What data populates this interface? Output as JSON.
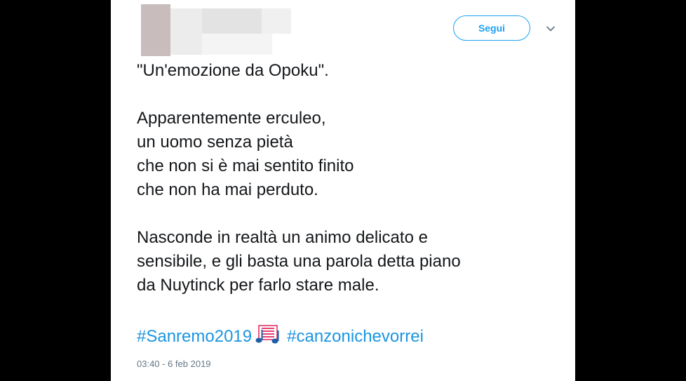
{
  "follow_button": {
    "label": "Segui"
  },
  "tweet": {
    "lines": [
      "\"Un'emozione da Opoku\".",
      "",
      "Apparentemente erculeo,",
      "un uomo senza pietà",
      "che non si è mai sentito finito",
      "che non ha mai perduto.",
      "",
      "Nasconde in realtà un animo delicato e",
      "sensibile, e gli basta una parola detta piano",
      "da Nuytinck per farlo stare male."
    ],
    "hashtags": [
      "#Sanremo2019",
      "#canzonichevorrei"
    ],
    "emoji_icon": "musical-score-icon",
    "timestamp": "03:40 - 6 feb 2019"
  },
  "colors": {
    "accent": "#1da1f2",
    "hashtag": "#1b95e0",
    "text": "#14171a",
    "muted": "#657786",
    "background": "#000000"
  }
}
